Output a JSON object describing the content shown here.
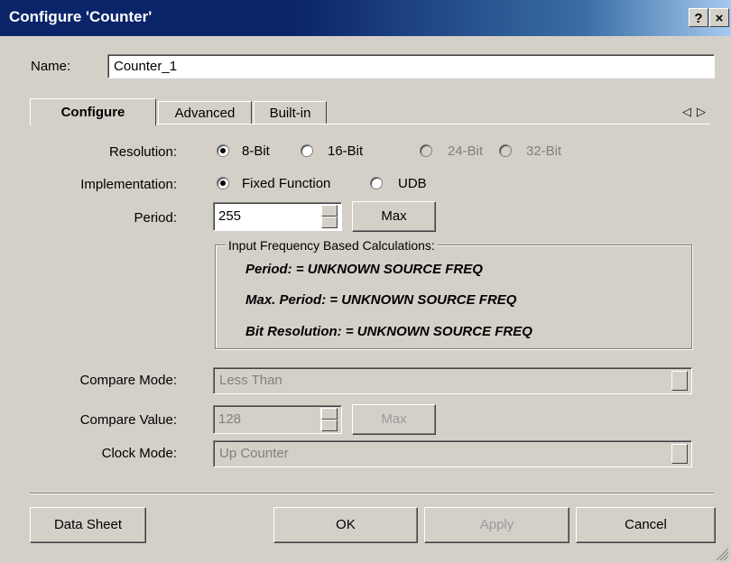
{
  "window": {
    "title": "Configure 'Counter'",
    "help_glyph": "?",
    "close_glyph": "×"
  },
  "name_row": {
    "label": "Name:",
    "value": "Counter_1"
  },
  "tabs": [
    {
      "label": "Configure",
      "active": true
    },
    {
      "label": "Advanced",
      "active": false
    },
    {
      "label": "Built-in",
      "active": false
    }
  ],
  "tab_scroll": {
    "left": "◁",
    "right": "▷"
  },
  "resolution": {
    "label": "Resolution:",
    "options": [
      {
        "label": "8-Bit",
        "selected": true,
        "enabled": true
      },
      {
        "label": "16-Bit",
        "selected": false,
        "enabled": true
      },
      {
        "label": "24-Bit",
        "selected": false,
        "enabled": false
      },
      {
        "label": "32-Bit",
        "selected": false,
        "enabled": false
      }
    ]
  },
  "implementation": {
    "label": "Implementation:",
    "options": [
      {
        "label": "Fixed Function",
        "selected": true
      },
      {
        "label": "UDB",
        "selected": false
      }
    ]
  },
  "period": {
    "label": "Period:",
    "value": "255",
    "max_label": "Max"
  },
  "calculations": {
    "legend": "Input Frequency Based Calculations:",
    "lines": [
      "Period: = UNKNOWN SOURCE FREQ",
      "Max. Period: = UNKNOWN SOURCE FREQ",
      "Bit Resolution: = UNKNOWN SOURCE FREQ"
    ]
  },
  "compare_mode": {
    "label": "Compare Mode:",
    "value": "Less Than",
    "enabled": false
  },
  "compare_value": {
    "label": "Compare Value:",
    "value": "128",
    "max_label": "Max",
    "enabled": false
  },
  "clock_mode": {
    "label": "Clock Mode:",
    "value": "Up Counter",
    "enabled": false
  },
  "footer": {
    "datasheet": "Data Sheet",
    "ok": "OK",
    "apply": "Apply",
    "cancel": "Cancel"
  },
  "colors": {
    "title_bar": "#0a246a",
    "face": "#d4d0c8",
    "disabled_text": "#808080"
  }
}
